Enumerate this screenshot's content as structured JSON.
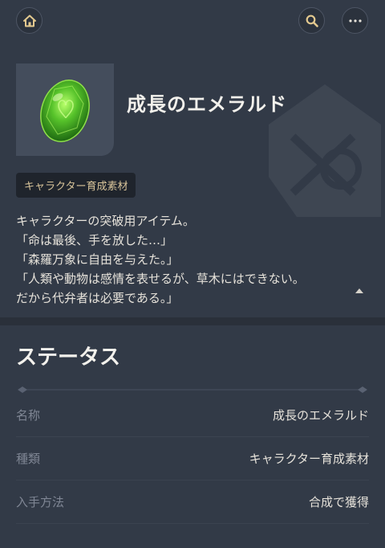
{
  "topbar": {
    "home_icon": "home-icon",
    "search_icon": "search-icon",
    "more_icon": "more-icon"
  },
  "item": {
    "title": "成長のエメラルド",
    "tag": "キャラクター育成素材",
    "description": [
      "キャラクターの突破用アイテム。",
      "「命は最後、手を放した…」",
      "「森羅万象に自由を与えた。」",
      "「人類や動物は感情を表せるが、草木にはできない。",
      "だから代弁者は必要である。」"
    ]
  },
  "status": {
    "title": "ステータス",
    "rows": [
      {
        "key": "名称",
        "value": "成長のエメラルド"
      },
      {
        "key": "種類",
        "value": "キャラクター育成素材"
      },
      {
        "key": "入手方法",
        "value": "合成で獲得"
      }
    ]
  },
  "colors": {
    "background": "#323a47",
    "accent_gold": "#d8c49a",
    "gem_green": "#4caf2a"
  }
}
